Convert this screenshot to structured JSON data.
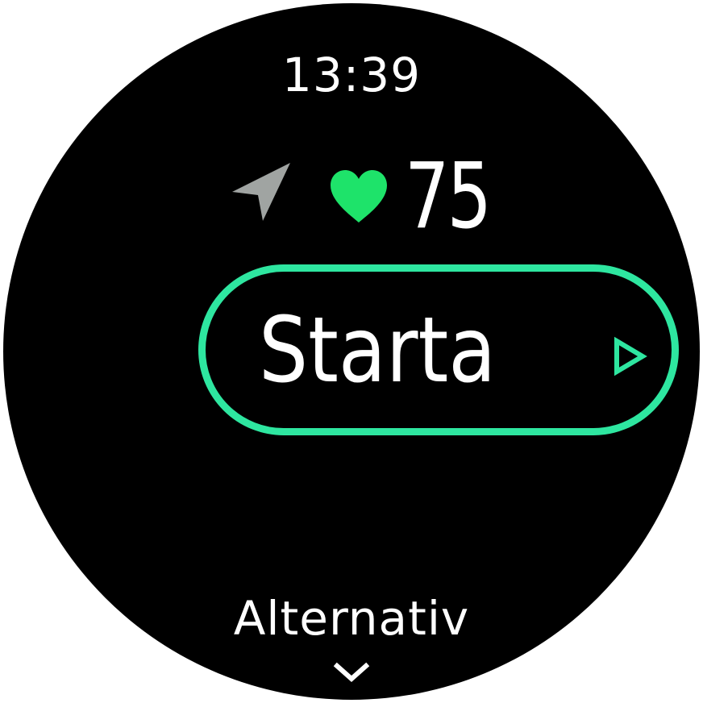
{
  "watch": {
    "time": "13:39",
    "heart_rate": "75",
    "start_label": "Starta",
    "options_label": "Alternativ"
  },
  "icons": {
    "navigation": "navigation-arrow-icon",
    "heart": "heart-icon",
    "play": "play-triangle-icon",
    "chevron": "chevron-down-icon"
  },
  "colors": {
    "background": "#000000",
    "text": "#ffffff",
    "accent": "#2ee6a0",
    "heart": "#1ee36a",
    "nav_icon": "#a0a4a2"
  }
}
